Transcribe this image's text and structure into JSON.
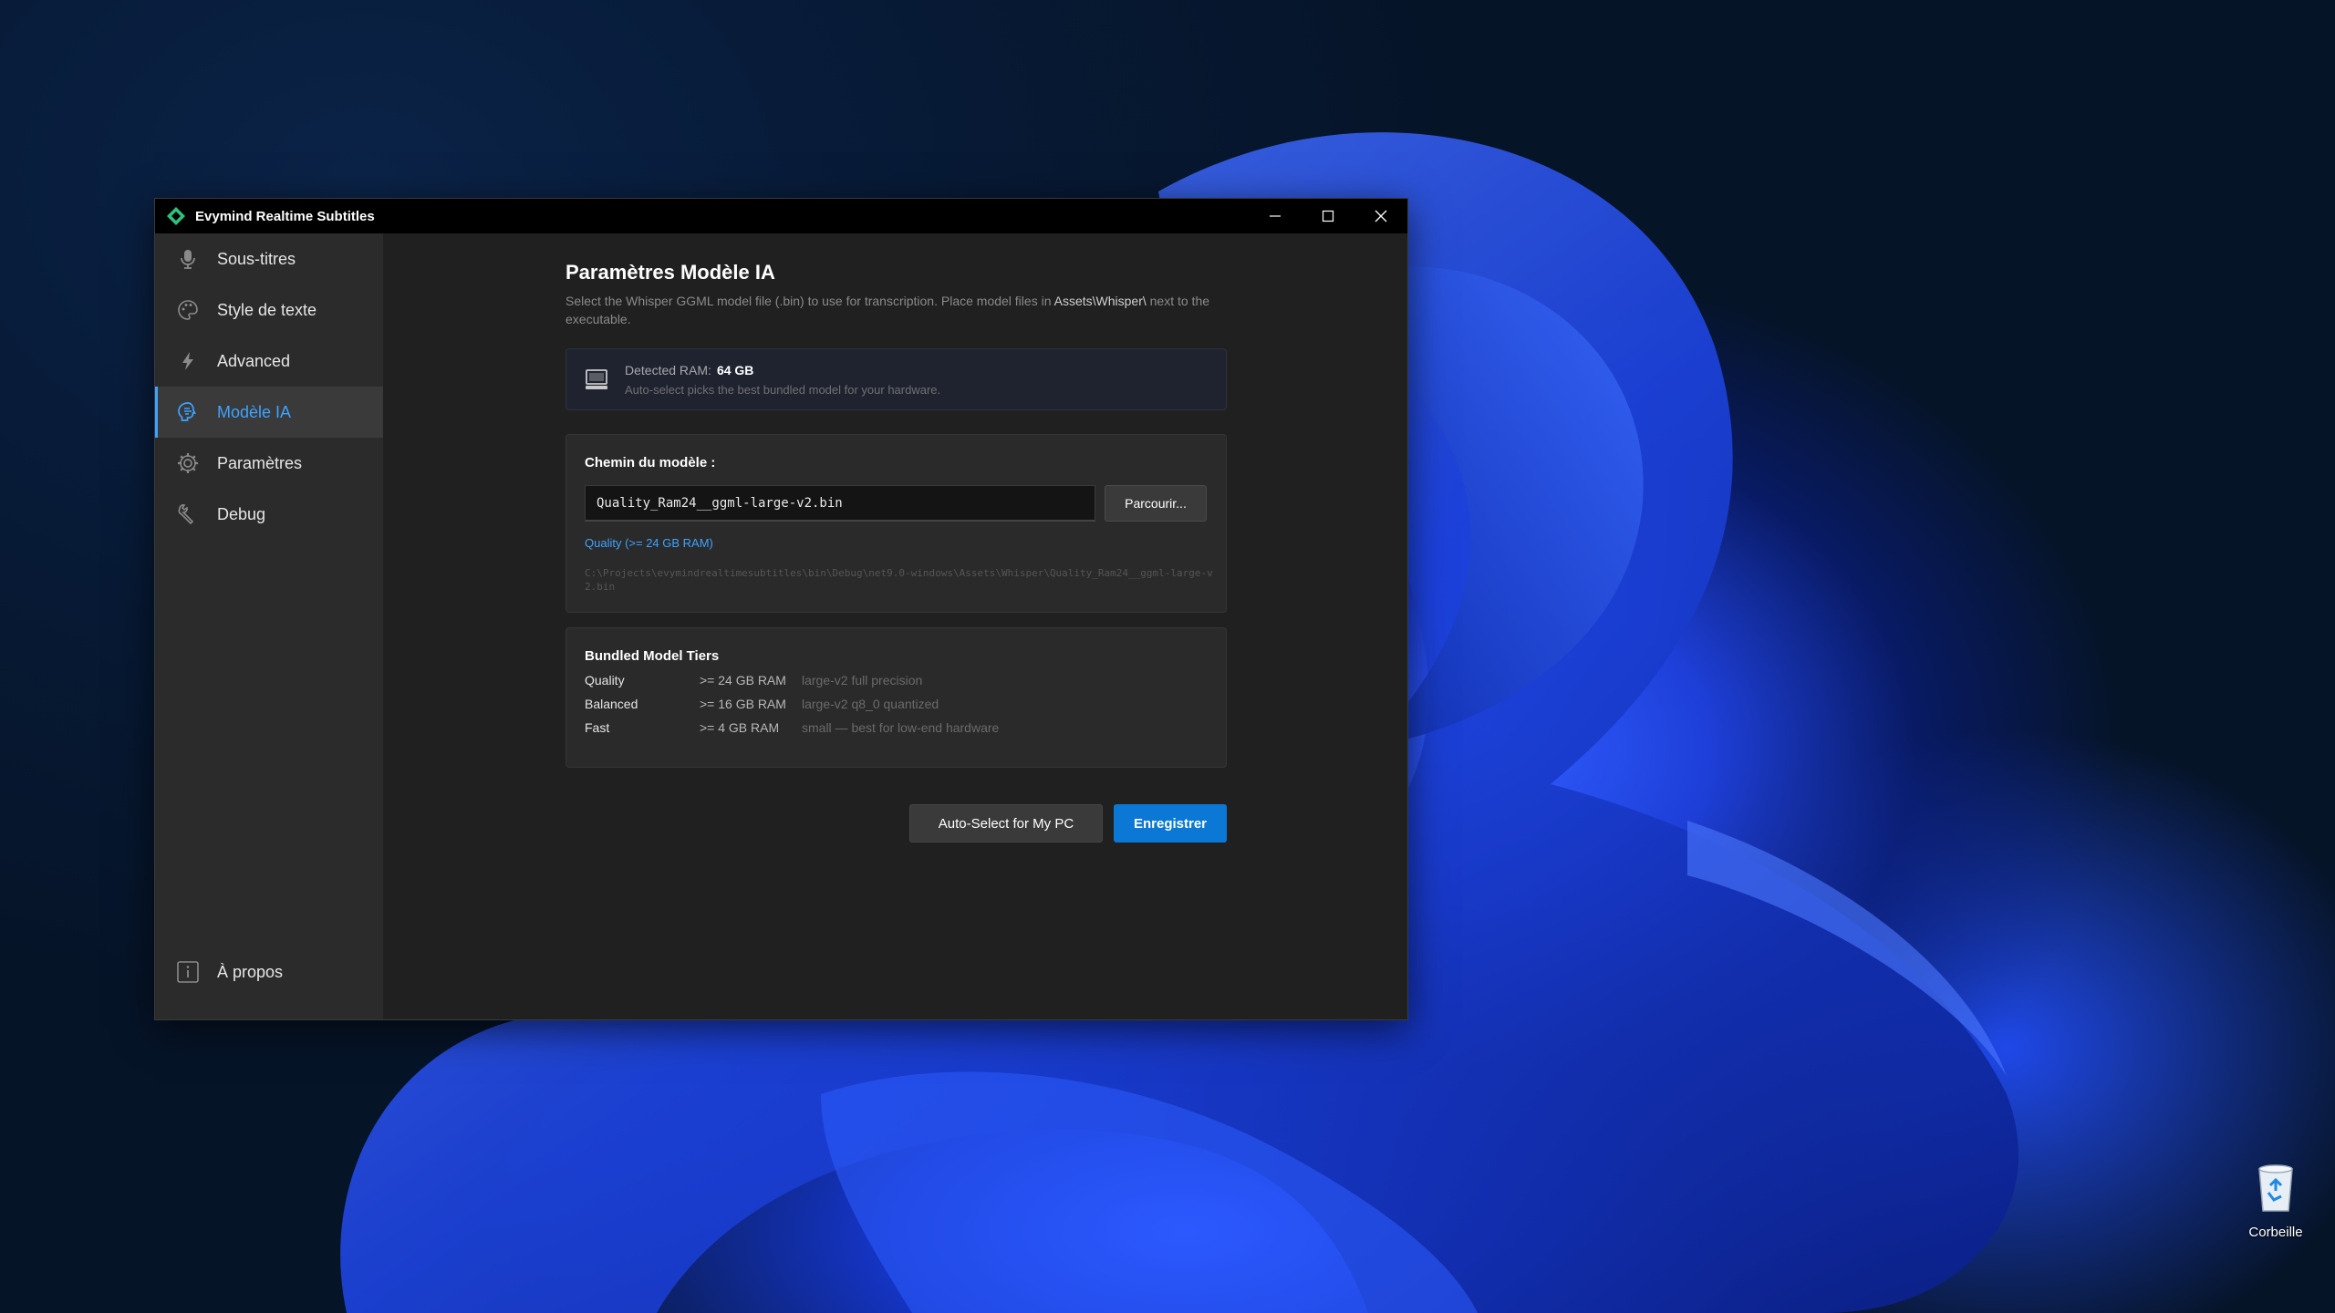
{
  "window": {
    "title": "Evymind Realtime Subtitles"
  },
  "sidebar": {
    "items": [
      {
        "label": "Sous-titres",
        "icon": "microphone-icon"
      },
      {
        "label": "Style de texte",
        "icon": "palette-icon"
      },
      {
        "label": "Advanced",
        "icon": "lightning-icon"
      },
      {
        "label": "Modèle IA",
        "icon": "brain-icon",
        "active": true
      },
      {
        "label": "Paramètres",
        "icon": "gear-icon"
      },
      {
        "label": "Debug",
        "icon": "wrench-icon"
      }
    ],
    "bottom": {
      "label": "À propos",
      "icon": "info-icon"
    }
  },
  "main": {
    "title": "Paramètres Modèle IA",
    "description_pre": "Select the Whisper GGML model file (.bin) to use for transcription. Place model files in ",
    "description_hl": "Assets\\Whisper\\",
    "description_post": " next to the executable.",
    "ram": {
      "label": "Detected RAM:",
      "value": "64 GB",
      "hint": "Auto-select picks the best bundled model for your hardware."
    },
    "model_path": {
      "heading": "Chemin du modèle :",
      "value": "Quality_Ram24__ggml-large-v2.bin",
      "browse_label": "Parcourir...",
      "tier_link": "Quality (>= 24 GB RAM)",
      "full_path": "C:\\Projects\\evymindrealtimesubtitles\\bin\\Debug\\net9.0-windows\\Assets\\Whisper\\Quality_Ram24__ggml-large-v2.bin"
    },
    "tiers": {
      "heading": "Bundled Model Tiers",
      "rows": [
        {
          "name": "Quality",
          "ram": ">= 24 GB RAM",
          "desc": "large-v2 full precision"
        },
        {
          "name": "Balanced",
          "ram": ">= 16 GB RAM",
          "desc": "large-v2 q8_0 quantized"
        },
        {
          "name": "Fast",
          "ram": ">= 4 GB RAM",
          "desc": "small — best for low-end hardware"
        }
      ]
    },
    "actions": {
      "auto_select": "Auto-Select for My PC",
      "save": "Enregistrer"
    }
  },
  "desktop": {
    "recycle_bin": "Corbeille"
  },
  "colors": {
    "accent": "#3ea3ff",
    "save_button": "#0a78d4",
    "sidebar_bg": "#2b2b2b",
    "content_bg": "#202020"
  }
}
